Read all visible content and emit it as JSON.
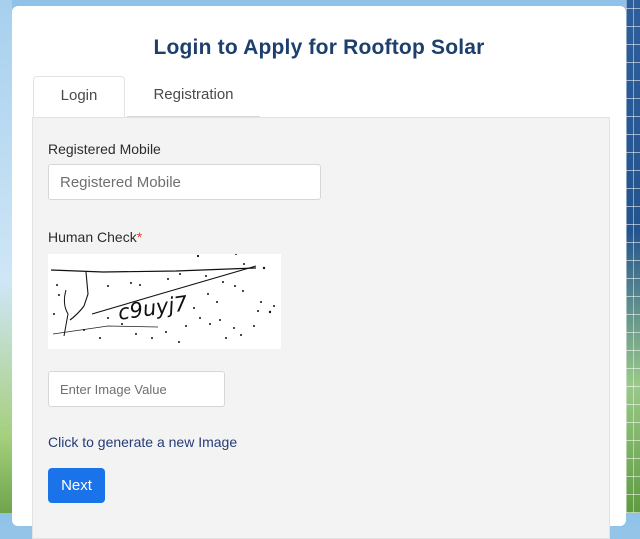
{
  "title": "Login to Apply for Rooftop Solar",
  "tabs": [
    {
      "label": "Login",
      "active": true
    },
    {
      "label": "Registration",
      "active": false
    }
  ],
  "form": {
    "mobile_label": "Registered Mobile",
    "mobile_placeholder": "Registered Mobile",
    "mobile_value": "",
    "human_check_label": "Human Check",
    "required_marker": "*",
    "captcha_text": "c9uyj7",
    "captcha_placeholder": "Enter Image Value",
    "captcha_value": "",
    "regenerate_link": "Click to generate a new Image",
    "next_button": "Next"
  },
  "colors": {
    "title": "#1d3f6b",
    "active_tab_underline": "#f2a24a",
    "link": "#253b78",
    "button": "#1a73e8",
    "required": "#e53935"
  }
}
